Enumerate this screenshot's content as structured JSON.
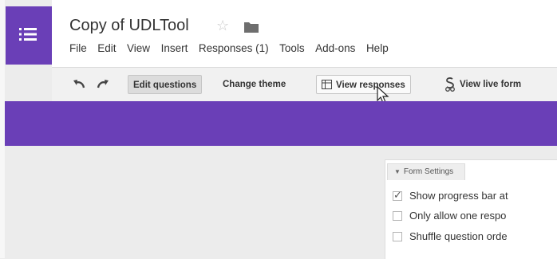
{
  "app": {
    "title": "Copy of UDLTool",
    "star_icon": "star-outline-icon",
    "folder_icon": "folder-icon",
    "brand_color": "#6a3fb7"
  },
  "menu": [
    "File",
    "Edit",
    "View",
    "Insert",
    "Responses (1)",
    "Tools",
    "Add-ons",
    "Help"
  ],
  "toolbar": {
    "undo_icon": "undo-icon",
    "redo_icon": "redo-icon",
    "edit_questions": "Edit questions",
    "change_theme": "Change theme",
    "view_responses": "View responses",
    "view_live_form": "View live form"
  },
  "form_settings": {
    "tab_label": "Form Settings",
    "options": [
      {
        "label": "Show progress bar at",
        "checked": true
      },
      {
        "label": "Only allow one respo",
        "checked": false
      },
      {
        "label": "Shuffle question orde",
        "checked": false
      }
    ]
  }
}
